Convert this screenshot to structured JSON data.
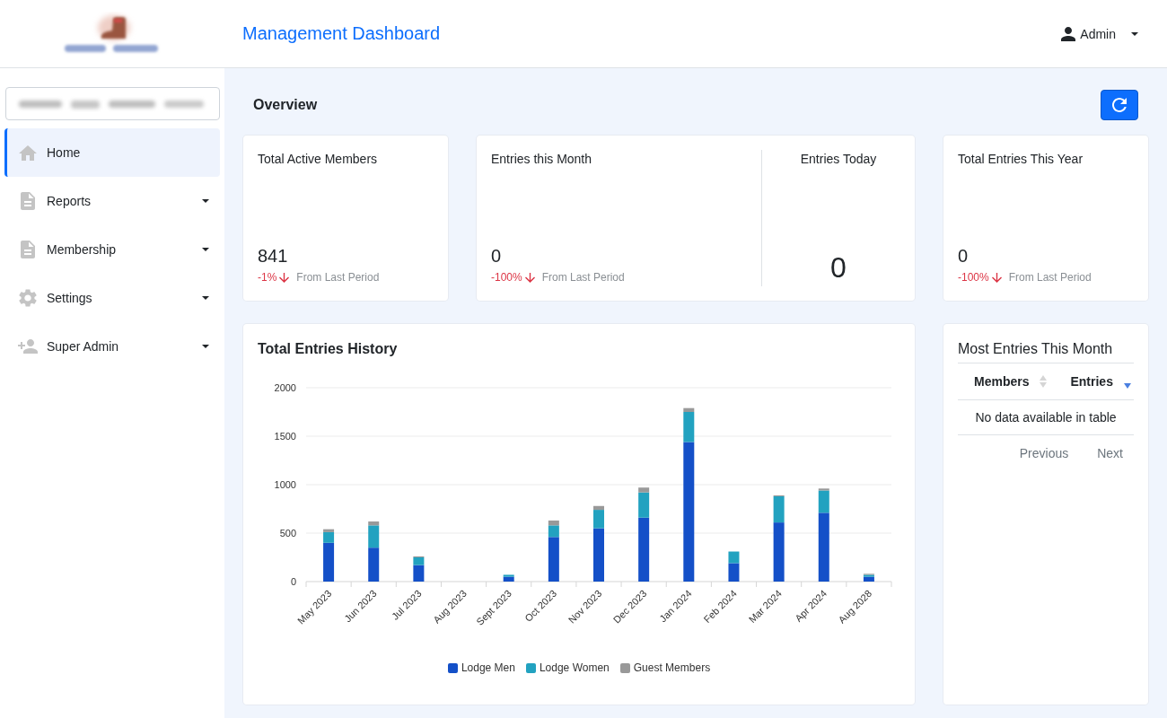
{
  "header": {
    "title": "Management Dashboard",
    "user_menu": {
      "label": "Admin"
    }
  },
  "sidebar": {
    "items": [
      {
        "label": "Home",
        "selected": true,
        "has_submenu": false
      },
      {
        "label": "Reports",
        "selected": false,
        "has_submenu": true
      },
      {
        "label": "Membership",
        "selected": false,
        "has_submenu": true
      },
      {
        "label": "Settings",
        "selected": false,
        "has_submenu": true
      },
      {
        "label": "Super Admin",
        "selected": false,
        "has_submenu": true
      }
    ]
  },
  "overview": {
    "title": "Overview"
  },
  "stat_cards": [
    {
      "panels": [
        {
          "kind": "trend",
          "title": "Total Active Members",
          "value": "841",
          "change": "-1%",
          "decrease": true,
          "note": "From Last Period"
        }
      ]
    },
    {
      "panels": [
        {
          "kind": "trend",
          "title": "Entries this Month",
          "value": "0",
          "change": "-100%",
          "decrease": true,
          "note": "From Last Period"
        },
        {
          "kind": "big",
          "title": "Entries Today",
          "value": "0"
        }
      ]
    },
    {
      "panels": [
        {
          "kind": "trend",
          "title": "Total Entries This Year",
          "value": "0",
          "change": "-100%",
          "decrease": true,
          "note": "From Last Period"
        }
      ]
    }
  ],
  "entries_history": {
    "chart_data": {
      "type": "bar",
      "title": "Total Entries History",
      "categories": [
        "May 2023",
        "Jun 2023",
        "Jul 2023",
        "Aug 2023",
        "Sept 2023",
        "Oct 2023",
        "Nov 2023",
        "Dec 2023",
        "Jan 2024",
        "Feb 2024",
        "Mar 2024",
        "Apr 2024",
        "Aug 2028"
      ],
      "series": [
        {
          "name": "Lodge Men",
          "color": "#1450c8",
          "values": [
            400,
            350,
            170,
            0,
            50,
            460,
            550,
            660,
            1440,
            190,
            610,
            710,
            50
          ]
        },
        {
          "name": "Lodge Women",
          "color": "#22a2c0",
          "values": [
            110,
            230,
            80,
            0,
            20,
            120,
            190,
            260,
            310,
            120,
            270,
            230,
            20
          ]
        },
        {
          "name": "Guest Members",
          "color": "#999999",
          "values": [
            30,
            40,
            10,
            0,
            0,
            50,
            40,
            50,
            40,
            0,
            10,
            20,
            10
          ]
        }
      ],
      "ylim": [
        0,
        2000
      ],
      "yticks": [
        0,
        500,
        1000,
        1500,
        2000
      ],
      "stacked": true,
      "grid": true,
      "legend": "bottom"
    }
  },
  "top_members": {
    "title": "Most Entries This Month",
    "columns": [
      {
        "label": "Members",
        "sorted": false
      },
      {
        "label": "Entries",
        "sorted": true,
        "descending": true
      }
    ],
    "empty_message": "No data available in table",
    "pagination": [
      {
        "label": "Previous",
        "disabled": true
      },
      {
        "label": "Next",
        "disabled": true
      }
    ]
  }
}
